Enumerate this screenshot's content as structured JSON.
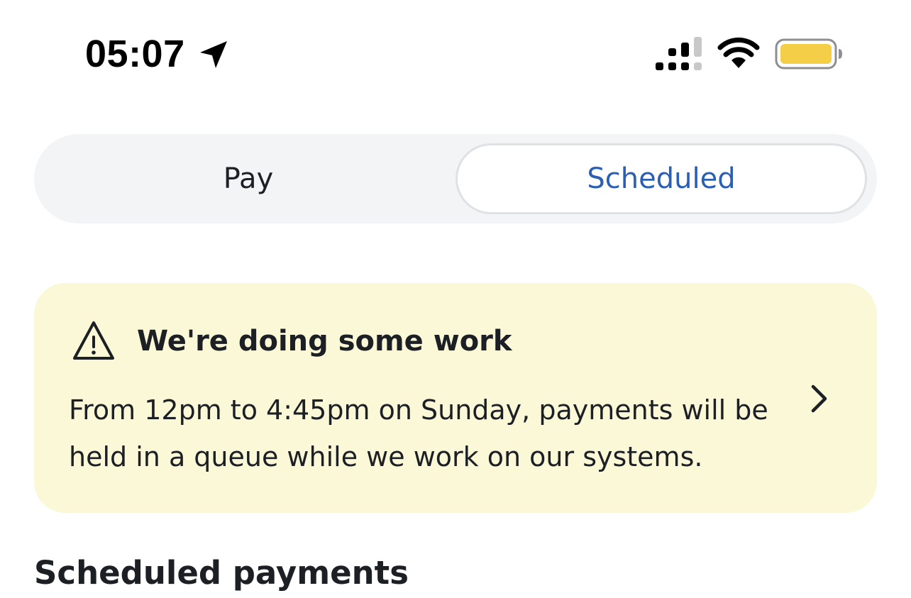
{
  "status_bar": {
    "time": "05:07",
    "icons": [
      "location-arrow-icon",
      "cellular-signal-icon",
      "wifi-icon",
      "battery-icon"
    ],
    "battery_color": "#f5ce47"
  },
  "segmented_control": {
    "tabs": [
      {
        "label": "Pay",
        "selected": false
      },
      {
        "label": "Scheduled",
        "selected": true
      }
    ],
    "selected_color": "#2a5fb4"
  },
  "notice": {
    "icon": "warning-triangle-icon",
    "title": "We're doing some work",
    "body": "From 12pm to 4:45pm on Sunday, payments will be held in a queue while we work on our systems.",
    "background_color": "#fbf8d8"
  },
  "section": {
    "title": "Scheduled payments"
  }
}
